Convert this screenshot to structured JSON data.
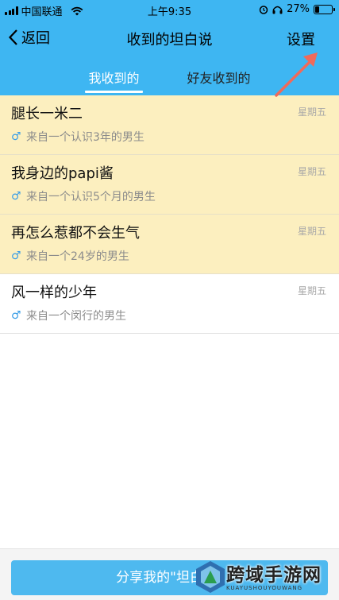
{
  "status_bar": {
    "carrier": "中国联通",
    "time": "上午9:35",
    "battery_text": "27%",
    "battery_level": 0.27
  },
  "nav": {
    "back_label": "返回",
    "title": "收到的坦白说",
    "settings_label": "设置"
  },
  "tabs": [
    {
      "label": "我收到的",
      "active": true
    },
    {
      "label": "好友收到的",
      "active": false
    }
  ],
  "messages": [
    {
      "title": "腿长一米二",
      "subtitle": "来自一个认识3年的男生",
      "day": "星期五",
      "unread": true
    },
    {
      "title": "我身边的papi酱",
      "subtitle": "来自一个认识5个月的男生",
      "day": "星期五",
      "unread": true
    },
    {
      "title": "再怎么惹都不会生气",
      "subtitle": "来自一个24岁的男生",
      "day": "星期五",
      "unread": true
    },
    {
      "title": "风一样的少年",
      "subtitle": "来自一个闵行的男生",
      "day": "星期五",
      "unread": false
    }
  ],
  "share_button": {
    "label": "分享我的\"坦白说\""
  },
  "watermark": {
    "text": "跨域手游网",
    "sub": "KUAYUSHOUYOUWANG"
  },
  "colors": {
    "accent": "#3eb6f2",
    "unread_bg": "#fcefbf",
    "annotation_arrow": "#f06a5a"
  }
}
